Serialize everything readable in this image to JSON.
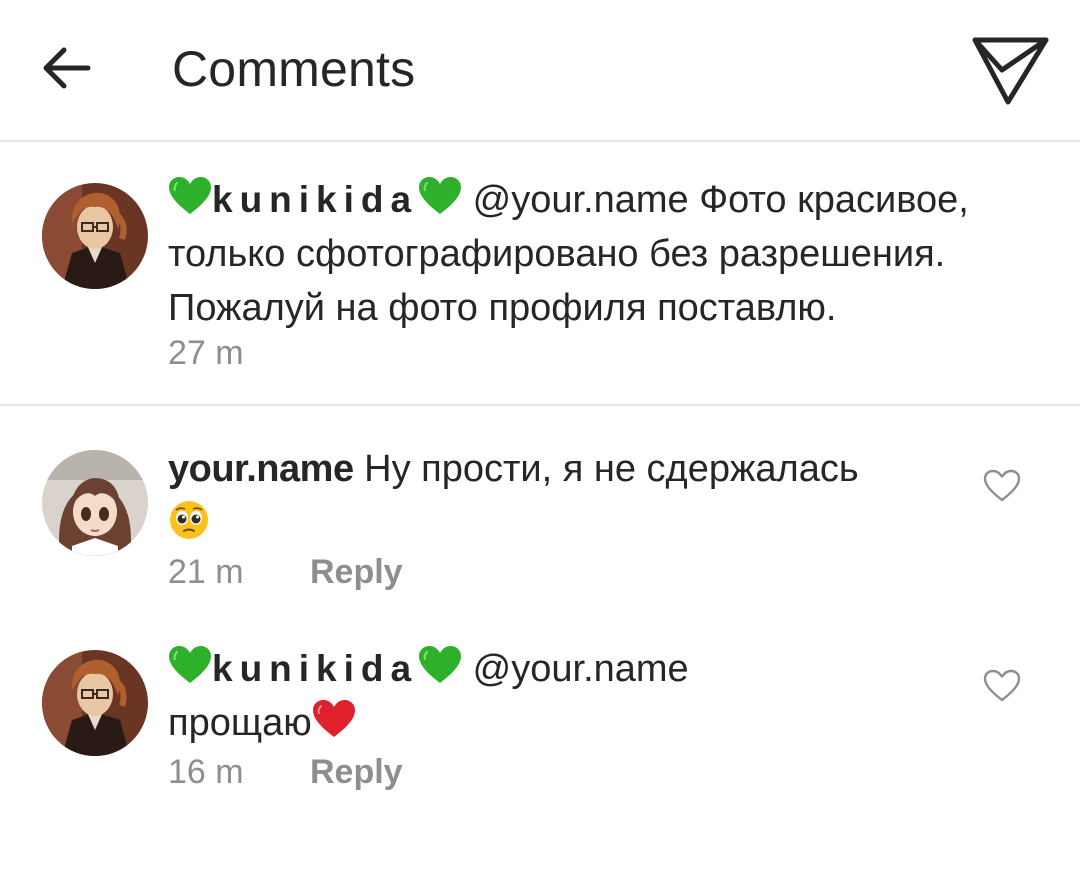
{
  "header": {
    "title": "Comments",
    "back_icon": "arrow-left-icon",
    "send_icon": "paper-plane-icon"
  },
  "colors": {
    "text": "#262626",
    "meta": "#8e8e8e",
    "divider": "#e6e6e6",
    "green_heart": "#2fb02a",
    "red_heart": "#e0202b"
  },
  "comments": [
    {
      "username": "kunikida",
      "mention": "@your.name",
      "text_line1": "Фото красивое,",
      "text_line2": "только сфотографировано без разрешения.",
      "text_line3": "Пожалуй на фото профиля поставлю.",
      "time": "27 m"
    },
    {
      "username": "your.name",
      "text": "Ну прости, я не сдержалась",
      "time": "21 m",
      "reply_label": "Reply"
    },
    {
      "username": "kunikida",
      "mention": "@your.name",
      "text": "прощаю",
      "time": "16 m",
      "reply_label": "Reply"
    }
  ]
}
